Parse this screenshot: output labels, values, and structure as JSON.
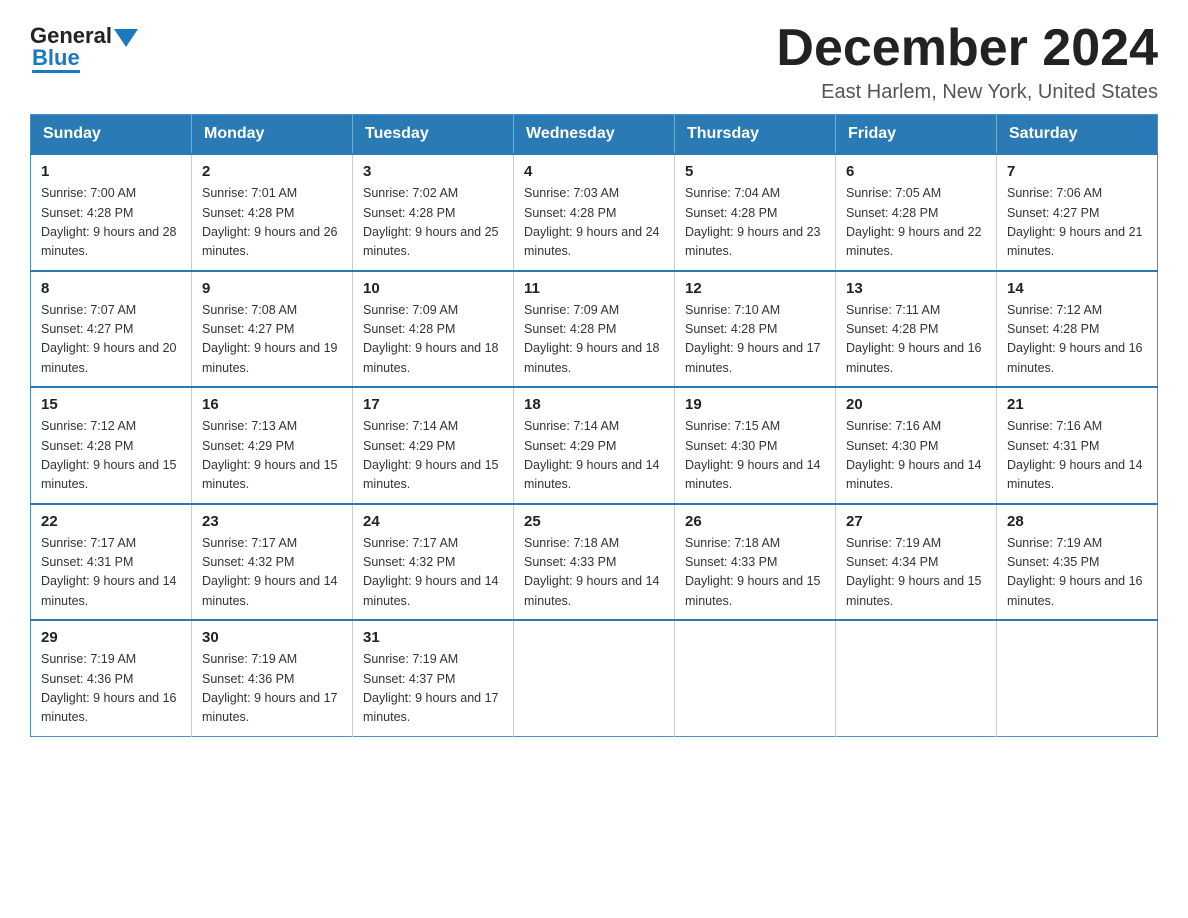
{
  "header": {
    "title": "December 2024",
    "location": "East Harlem, New York, United States",
    "logo_general": "General",
    "logo_blue": "Blue"
  },
  "days_of_week": [
    "Sunday",
    "Monday",
    "Tuesday",
    "Wednesday",
    "Thursday",
    "Friday",
    "Saturday"
  ],
  "weeks": [
    [
      {
        "day": "1",
        "sunrise": "7:00 AM",
        "sunset": "4:28 PM",
        "daylight": "9 hours and 28 minutes."
      },
      {
        "day": "2",
        "sunrise": "7:01 AM",
        "sunset": "4:28 PM",
        "daylight": "9 hours and 26 minutes."
      },
      {
        "day": "3",
        "sunrise": "7:02 AM",
        "sunset": "4:28 PM",
        "daylight": "9 hours and 25 minutes."
      },
      {
        "day": "4",
        "sunrise": "7:03 AM",
        "sunset": "4:28 PM",
        "daylight": "9 hours and 24 minutes."
      },
      {
        "day": "5",
        "sunrise": "7:04 AM",
        "sunset": "4:28 PM",
        "daylight": "9 hours and 23 minutes."
      },
      {
        "day": "6",
        "sunrise": "7:05 AM",
        "sunset": "4:28 PM",
        "daylight": "9 hours and 22 minutes."
      },
      {
        "day": "7",
        "sunrise": "7:06 AM",
        "sunset": "4:27 PM",
        "daylight": "9 hours and 21 minutes."
      }
    ],
    [
      {
        "day": "8",
        "sunrise": "7:07 AM",
        "sunset": "4:27 PM",
        "daylight": "9 hours and 20 minutes."
      },
      {
        "day": "9",
        "sunrise": "7:08 AM",
        "sunset": "4:27 PM",
        "daylight": "9 hours and 19 minutes."
      },
      {
        "day": "10",
        "sunrise": "7:09 AM",
        "sunset": "4:28 PM",
        "daylight": "9 hours and 18 minutes."
      },
      {
        "day": "11",
        "sunrise": "7:09 AM",
        "sunset": "4:28 PM",
        "daylight": "9 hours and 18 minutes."
      },
      {
        "day": "12",
        "sunrise": "7:10 AM",
        "sunset": "4:28 PM",
        "daylight": "9 hours and 17 minutes."
      },
      {
        "day": "13",
        "sunrise": "7:11 AM",
        "sunset": "4:28 PM",
        "daylight": "9 hours and 16 minutes."
      },
      {
        "day": "14",
        "sunrise": "7:12 AM",
        "sunset": "4:28 PM",
        "daylight": "9 hours and 16 minutes."
      }
    ],
    [
      {
        "day": "15",
        "sunrise": "7:12 AM",
        "sunset": "4:28 PM",
        "daylight": "9 hours and 15 minutes."
      },
      {
        "day": "16",
        "sunrise": "7:13 AM",
        "sunset": "4:29 PM",
        "daylight": "9 hours and 15 minutes."
      },
      {
        "day": "17",
        "sunrise": "7:14 AM",
        "sunset": "4:29 PM",
        "daylight": "9 hours and 15 minutes."
      },
      {
        "day": "18",
        "sunrise": "7:14 AM",
        "sunset": "4:29 PM",
        "daylight": "9 hours and 14 minutes."
      },
      {
        "day": "19",
        "sunrise": "7:15 AM",
        "sunset": "4:30 PM",
        "daylight": "9 hours and 14 minutes."
      },
      {
        "day": "20",
        "sunrise": "7:16 AM",
        "sunset": "4:30 PM",
        "daylight": "9 hours and 14 minutes."
      },
      {
        "day": "21",
        "sunrise": "7:16 AM",
        "sunset": "4:31 PM",
        "daylight": "9 hours and 14 minutes."
      }
    ],
    [
      {
        "day": "22",
        "sunrise": "7:17 AM",
        "sunset": "4:31 PM",
        "daylight": "9 hours and 14 minutes."
      },
      {
        "day": "23",
        "sunrise": "7:17 AM",
        "sunset": "4:32 PM",
        "daylight": "9 hours and 14 minutes."
      },
      {
        "day": "24",
        "sunrise": "7:17 AM",
        "sunset": "4:32 PM",
        "daylight": "9 hours and 14 minutes."
      },
      {
        "day": "25",
        "sunrise": "7:18 AM",
        "sunset": "4:33 PM",
        "daylight": "9 hours and 14 minutes."
      },
      {
        "day": "26",
        "sunrise": "7:18 AM",
        "sunset": "4:33 PM",
        "daylight": "9 hours and 15 minutes."
      },
      {
        "day": "27",
        "sunrise": "7:19 AM",
        "sunset": "4:34 PM",
        "daylight": "9 hours and 15 minutes."
      },
      {
        "day": "28",
        "sunrise": "7:19 AM",
        "sunset": "4:35 PM",
        "daylight": "9 hours and 16 minutes."
      }
    ],
    [
      {
        "day": "29",
        "sunrise": "7:19 AM",
        "sunset": "4:36 PM",
        "daylight": "9 hours and 16 minutes."
      },
      {
        "day": "30",
        "sunrise": "7:19 AM",
        "sunset": "4:36 PM",
        "daylight": "9 hours and 17 minutes."
      },
      {
        "day": "31",
        "sunrise": "7:19 AM",
        "sunset": "4:37 PM",
        "daylight": "9 hours and 17 minutes."
      },
      null,
      null,
      null,
      null
    ]
  ]
}
